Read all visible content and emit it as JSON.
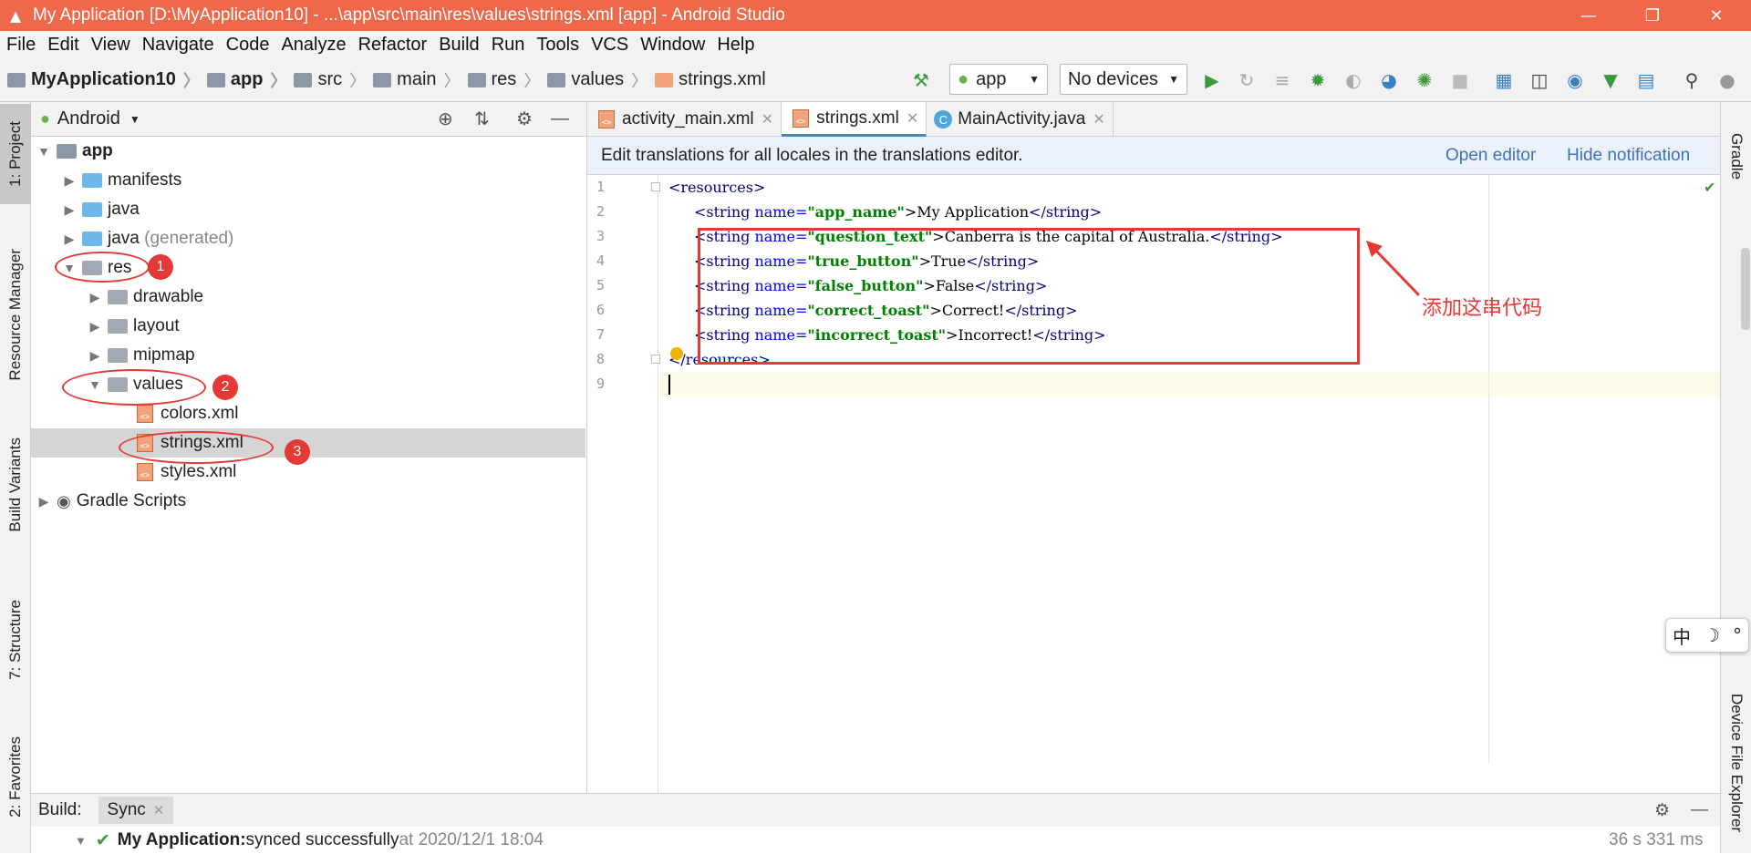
{
  "window": {
    "title": "My Application [D:\\MyApplication10] - ...\\app\\src\\main\\res\\values\\strings.xml [app] - Android Studio",
    "minimize": "—",
    "restore": "❐",
    "close": "✕"
  },
  "menu": [
    "File",
    "Edit",
    "View",
    "Navigate",
    "Code",
    "Analyze",
    "Refactor",
    "Build",
    "Run",
    "Tools",
    "VCS",
    "Window",
    "Help"
  ],
  "breadcrumb": [
    "MyApplication10",
    "app",
    "src",
    "main",
    "res",
    "values",
    "strings.xml"
  ],
  "toolbar": {
    "config": "app",
    "devices": "No devices"
  },
  "left_tabs": [
    "1: Project",
    "Resource Manager",
    "Build Variants",
    "7: Structure",
    "2: Favorites"
  ],
  "right_tabs": [
    "Gradle",
    "Device File Explorer"
  ],
  "project": {
    "view": "Android",
    "tree": [
      {
        "label": "app",
        "bold": true
      },
      {
        "label": "manifests"
      },
      {
        "label": "java"
      },
      {
        "label": "java",
        "suffix": "(generated)"
      },
      {
        "label": "res"
      },
      {
        "label": "drawable"
      },
      {
        "label": "layout"
      },
      {
        "label": "mipmap"
      },
      {
        "label": "values"
      },
      {
        "label": "colors.xml"
      },
      {
        "label": "strings.xml"
      },
      {
        "label": "styles.xml"
      },
      {
        "label": "Gradle Scripts"
      }
    ],
    "badges": [
      "1",
      "2",
      "3"
    ]
  },
  "tabs": [
    {
      "label": "activity_main.xml"
    },
    {
      "label": "strings.xml",
      "active": true
    },
    {
      "label": "MainActivity.java"
    }
  ],
  "notification": {
    "text": "Edit translations for all locales in the translations editor.",
    "open": "Open editor",
    "hide": "Hide notification"
  },
  "code": {
    "line_numbers": [
      "1",
      "2",
      "3",
      "4",
      "5",
      "6",
      "7",
      "8",
      "9"
    ],
    "lines": [
      {
        "open": "<resources>",
        "close": ""
      },
      {
        "open": "<string ",
        "attr": "name=",
        "val": "\"app_name\"",
        "text": ">My Application",
        "close": "</string>"
      },
      {
        "open": "<string ",
        "attr": "name=",
        "val": "\"question_text\"",
        "text": ">Canberra is the capital of Australia.",
        "close": "</string>"
      },
      {
        "open": "<string ",
        "attr": "name=",
        "val": "\"true_button\"",
        "text": ">True",
        "close": "</string>"
      },
      {
        "open": "<string ",
        "attr": "name=",
        "val": "\"false_button\"",
        "text": ">False",
        "close": "</string>"
      },
      {
        "open": "<string ",
        "attr": "name=",
        "val": "\"correct_toast\"",
        "text": ">Correct!",
        "close": "</string>"
      },
      {
        "open": "<string ",
        "attr": "name=",
        "val": "\"incorrect_toast\"",
        "text": ">Incorrect!",
        "close": "</string>"
      },
      {
        "open": "</resources>",
        "close": ""
      }
    ]
  },
  "annotation": "添加这串代码",
  "build": {
    "label": "Build:",
    "tab": "Sync",
    "status_app": "My Application:",
    "status_msg": " synced successfully",
    "status_time": " at 2020/12/1 18:04",
    "duration": "36 s 331 ms"
  },
  "ime": {
    "lang": "中",
    "moon": "☽",
    "dot": "°"
  }
}
